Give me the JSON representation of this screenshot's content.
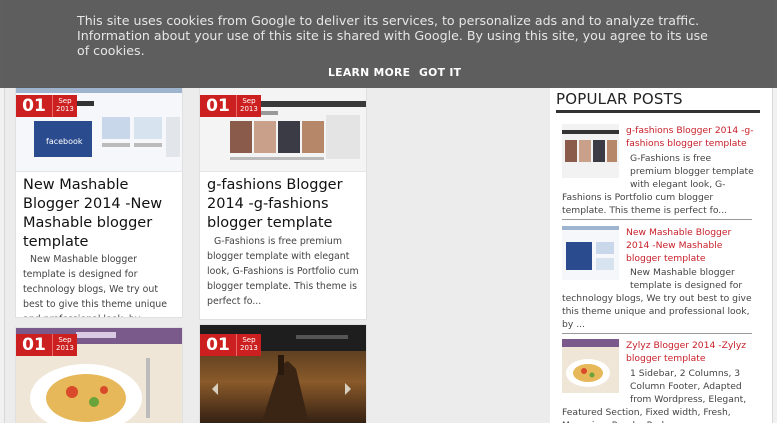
{
  "cookie_banner": {
    "message": "This site uses cookies from Google to deliver its services, to personalize ads and to analyze traffic. Information about your use of this site is shared with Google. By using this site, you agree to its use of cookies.",
    "learn_more": "LEARN MORE",
    "got_it": "GOT IT"
  },
  "posts": [
    {
      "day": "01",
      "month": "Sep",
      "year": "2013",
      "title": "New Mashable Blogger 2014 -New Mashable blogger template",
      "snippet": "New Mashable blogger template is designed for technology blogs, We try out best to give this theme unique and professional look, by ..."
    },
    {
      "day": "01",
      "month": "Sep",
      "year": "2013",
      "title": "g-fashions Blogger 2014 -g-fashions blogger template",
      "snippet": "G-Fashions is free premium blogger template with elegant look, G-Fashions is Portfolio cum blogger template. This theme is perfect fo..."
    },
    {
      "day": "01",
      "month": "Sep",
      "year": "2013"
    },
    {
      "day": "01",
      "month": "Sep",
      "year": "2013"
    }
  ],
  "sidebar": {
    "heading": "POPULAR POSTS",
    "items": [
      {
        "title": "g-fashions Blogger 2014 -g-fashions blogger template",
        "desc_first": "G-Fashions is free premium blogger template with elegant look, G-",
        "desc_rest": "Fashions is Portfolio cum blogger template. This theme is perfect fo..."
      },
      {
        "title": "New Mashable Blogger 2014 -New Mashable blogger template",
        "desc_first": "New Mashable blogger template is designed for",
        "desc_rest": "technology blogs, We try out best to give this theme unique and professional look, by ..."
      },
      {
        "title": "Zylyz Blogger 2014 -Zylyz blogger template",
        "desc_first": "1 Sidebar, 2 Columns, 3 Column Footer, Adapted from Wordpress, Elegant,",
        "desc_rest": "Featured Section, Fixed width, Fresh, Magazine, Purple, Red"
      }
    ]
  }
}
